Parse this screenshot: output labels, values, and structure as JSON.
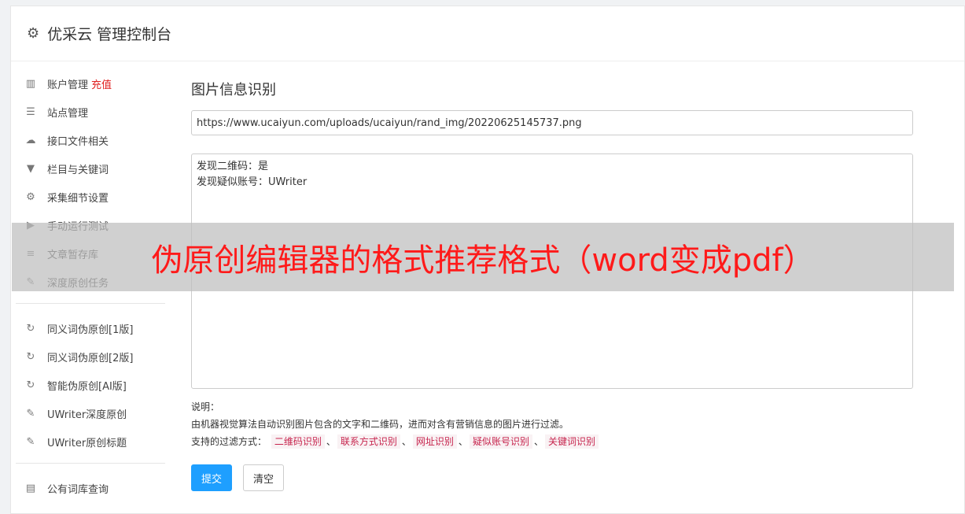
{
  "header": {
    "icon": "gear-icon",
    "title": "优采云 管理控制台"
  },
  "sidebar": {
    "groups": [
      [
        {
          "icon": "bar-chart-icon",
          "label": "账户管理",
          "badge": "充值"
        },
        {
          "icon": "server-icon",
          "label": "站点管理"
        },
        {
          "icon": "cloud-upload-icon",
          "label": "接口文件相关"
        },
        {
          "icon": "filter-icon",
          "label": "栏目与关键词"
        },
        {
          "icon": "cogs-icon",
          "label": "采集细节设置"
        },
        {
          "icon": "play-circle-icon",
          "label": "手动运行测试"
        },
        {
          "icon": "database-icon",
          "label": "文章暂存库"
        },
        {
          "icon": "edit-icon",
          "label": "深度原创任务"
        }
      ],
      [
        {
          "icon": "refresh-icon",
          "label": "同义词伪原创[1版]"
        },
        {
          "icon": "refresh-icon",
          "label": "同义词伪原创[2版]"
        },
        {
          "icon": "refresh-icon",
          "label": "智能伪原创[AI版]"
        },
        {
          "icon": "edit-icon",
          "label": "UWriter深度原创"
        },
        {
          "icon": "edit-icon",
          "label": "UWriter原创标题"
        }
      ],
      [
        {
          "icon": "book-icon",
          "label": "公有词库查询"
        }
      ]
    ]
  },
  "main": {
    "title": "图片信息识别",
    "url_value": "https://www.ucaiyun.com/uploads/ucaiyun/rand_img/20220625145737.png",
    "result_lines": [
      "发现二维码：是",
      "发现疑似账号：UWriter"
    ],
    "notes_label": "说明：",
    "notes_desc": "由机器视觉算法自动识别图片包含的文字和二维码，进而对含有营销信息的图片进行过滤。",
    "filter_label": "支持的过滤方式：",
    "filter_tags": [
      "二维码识别",
      "联系方式识别",
      "网址识别",
      "疑似账号识别",
      "关键词识别"
    ],
    "tag_separator": "、",
    "submit_label": "提交",
    "clear_label": "清空"
  },
  "overlay": {
    "text": "伪原创编辑器的格式推荐格式（word变成pdf）"
  },
  "colors": {
    "primary": "#1e9fff",
    "badge_red": "#e02020",
    "overlay_text": "#ff1a1a",
    "tag_text": "#c7254e",
    "tag_bg": "#f9f2f4"
  }
}
